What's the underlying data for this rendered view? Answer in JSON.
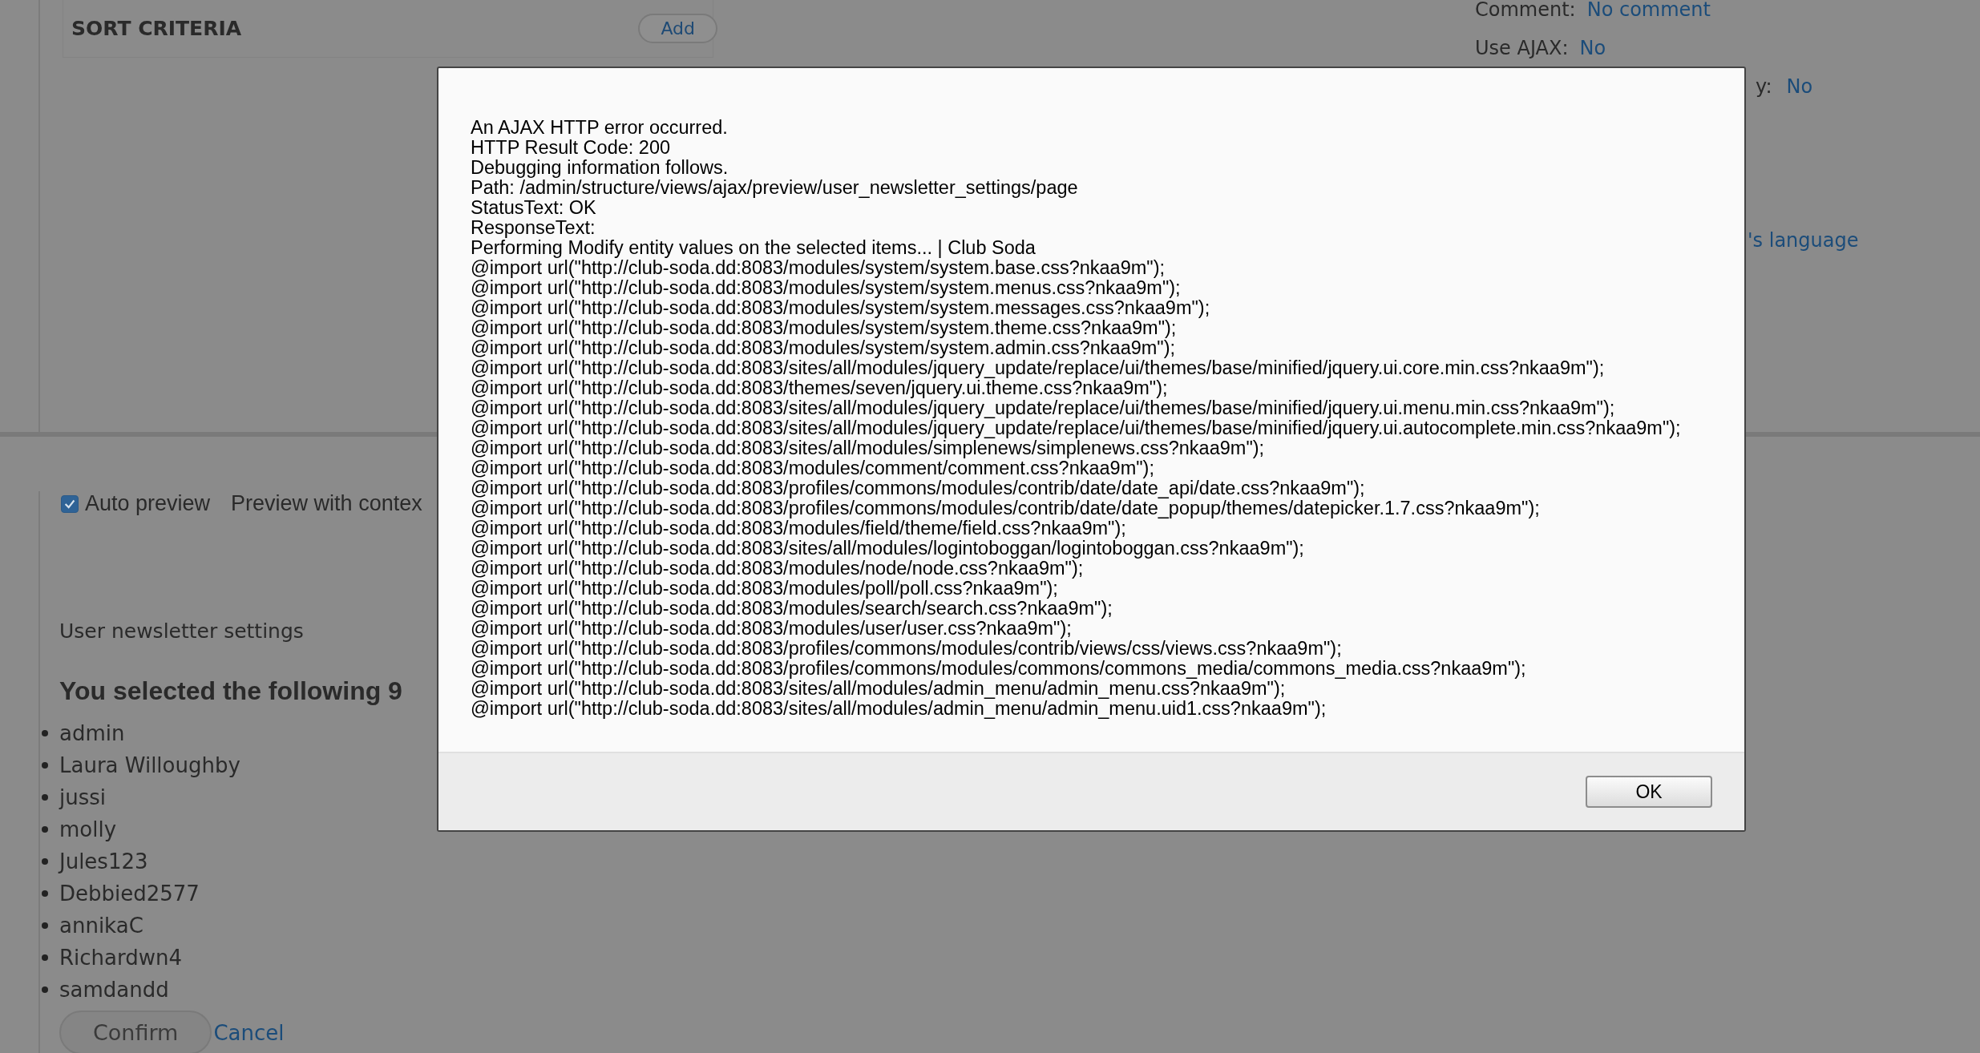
{
  "sort_criteria": {
    "title": "SORT CRITERIA",
    "add_button": "Add"
  },
  "settings": [
    {
      "label": "Comment:",
      "value": "No comment",
      "kind": "full"
    },
    {
      "label": "Use AJAX:",
      "value": "No",
      "kind": "full"
    },
    {
      "label": "y:",
      "value": "No",
      "kind": "cut"
    },
    {
      "value": "'s language",
      "kind": "cut"
    }
  ],
  "preview_bar": {
    "auto_preview": {
      "label": "Auto preview",
      "checked": true
    },
    "contextual_label": "Preview with contex"
  },
  "preview": {
    "title": "User newsletter settings",
    "heading": "You selected the following 9",
    "items": [
      "admin",
      "Laura Willoughby",
      "jussi",
      "molly",
      "Jules123",
      "Debbied2577",
      "annikaC",
      "Richardwn4",
      "samdandd"
    ],
    "confirm_button": "Confirm",
    "cancel_link": "Cancel"
  },
  "dialog": {
    "lines": [
      "An AJAX HTTP error occurred.",
      "HTTP Result Code: 200",
      "Debugging information follows.",
      "Path: /admin/structure/views/ajax/preview/user_newsletter_settings/page",
      "StatusText: OK",
      "ResponseText:",
      "Performing Modify entity values on the selected items... | Club Soda",
      "@import url(\"http://club-soda.dd:8083/modules/system/system.base.css?nkaa9m\");",
      "@import url(\"http://club-soda.dd:8083/modules/system/system.menus.css?nkaa9m\");",
      "@import url(\"http://club-soda.dd:8083/modules/system/system.messages.css?nkaa9m\");",
      "@import url(\"http://club-soda.dd:8083/modules/system/system.theme.css?nkaa9m\");",
      "@import url(\"http://club-soda.dd:8083/modules/system/system.admin.css?nkaa9m\");",
      "@import url(\"http://club-soda.dd:8083/sites/all/modules/jquery_update/replace/ui/themes/base/minified/jquery.ui.core.min.css?nkaa9m\");",
      "@import url(\"http://club-soda.dd:8083/themes/seven/jquery.ui.theme.css?nkaa9m\");",
      "@import url(\"http://club-soda.dd:8083/sites/all/modules/jquery_update/replace/ui/themes/base/minified/jquery.ui.menu.min.css?nkaa9m\");",
      "@import url(\"http://club-soda.dd:8083/sites/all/modules/jquery_update/replace/ui/themes/base/minified/jquery.ui.autocomplete.min.css?nkaa9m\");",
      "@import url(\"http://club-soda.dd:8083/sites/all/modules/simplenews/simplenews.css?nkaa9m\");",
      "@import url(\"http://club-soda.dd:8083/modules/comment/comment.css?nkaa9m\");",
      "@import url(\"http://club-soda.dd:8083/profiles/commons/modules/contrib/date/date_api/date.css?nkaa9m\");",
      "@import url(\"http://club-soda.dd:8083/profiles/commons/modules/contrib/date/date_popup/themes/datepicker.1.7.css?nkaa9m\");",
      "@import url(\"http://club-soda.dd:8083/modules/field/theme/field.css?nkaa9m\");",
      "@import url(\"http://club-soda.dd:8083/sites/all/modules/logintoboggan/logintoboggan.css?nkaa9m\");",
      "@import url(\"http://club-soda.dd:8083/modules/node/node.css?nkaa9m\");",
      "@import url(\"http://club-soda.dd:8083/modules/poll/poll.css?nkaa9m\");",
      "@import url(\"http://club-soda.dd:8083/modules/search/search.css?nkaa9m\");",
      "@import url(\"http://club-soda.dd:8083/modules/user/user.css?nkaa9m\");",
      "@import url(\"http://club-soda.dd:8083/profiles/commons/modules/contrib/views/css/views.css?nkaa9m\");",
      "@import url(\"http://club-soda.dd:8083/profiles/commons/modules/commons/commons_media/commons_media.css?nkaa9m\");",
      "@import url(\"http://club-soda.dd:8083/sites/all/modules/admin_menu/admin_menu.css?nkaa9m\");",
      "@import url(\"http://club-soda.dd:8083/sites/all/modules/admin_menu/admin_menu.uid1.css?nkaa9m\");"
    ],
    "ok_button": "OK"
  }
}
